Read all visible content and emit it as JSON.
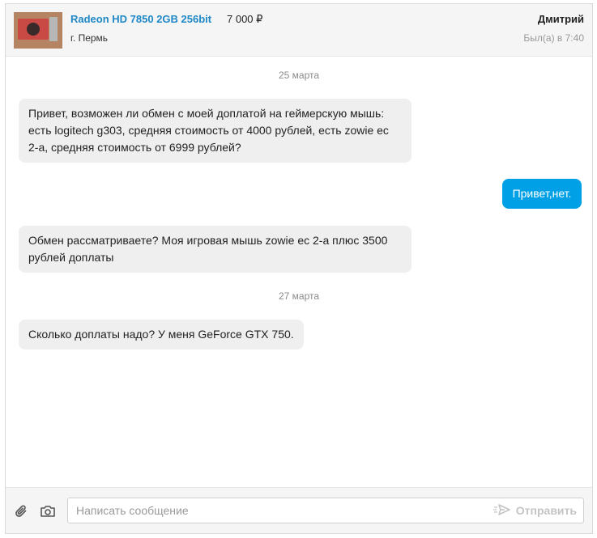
{
  "header": {
    "title": "Radeon HD 7850 2GB 256bit",
    "price": "7 000 ₽",
    "city": "г. Пермь",
    "user_name": "Дмитрий",
    "last_seen": "Был(а) в 7:40"
  },
  "messages": [
    {
      "date": "25 марта"
    },
    {
      "text": "Привет, возможен ли обмен с моей доплатой на геймерскую мышь: есть logitech g303, средняя стоимость от 4000 рублей, есть zowie ec 2-а, средняя стоимость от 6999 рублей?",
      "direction": "in"
    },
    {
      "text": "Привет,нет.",
      "direction": "out"
    },
    {
      "text": "Обмен рассматриваете? Моя игровая мышь zowie ec 2-a плюс 3500 рублей доплаты",
      "direction": "in"
    },
    {
      "date": "27 марта"
    },
    {
      "text": "Сколько доплаты надо? У меня GeForce GTX 750.",
      "direction": "in"
    }
  ],
  "composer": {
    "placeholder": "Написать сообщение",
    "send_label": "Отправить",
    "attach_icon": "paperclip-icon",
    "camera_icon": "camera-icon"
  },
  "colors": {
    "accent": "#00a0e6",
    "link": "#1e88c7",
    "bubble_in": "#efefef"
  }
}
